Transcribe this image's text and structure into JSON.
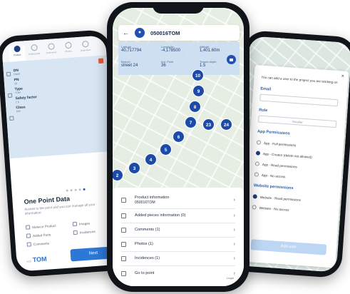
{
  "left": {
    "tabs": [
      {
        "label": "Product",
        "active": true
      },
      {
        "label": "Added parts",
        "active": false
      },
      {
        "label": "Comments",
        "active": false
      },
      {
        "label": "Photos",
        "active": false
      },
      {
        "label": "Incidences",
        "active": false
      }
    ],
    "fields": [
      {
        "key": "DN",
        "value": "DN00"
      },
      {
        "key": "PN",
        "value": "16"
      },
      {
        "key": "Type",
        "value": "TOM"
      },
      {
        "key": "Safety factor",
        "value": "1.6"
      },
      {
        "key": "Class",
        "value": "500"
      }
    ],
    "title": "One Point Data",
    "description": "Access to the point and you can manage all your information:",
    "items": [
      "Molecor Product",
      "Images",
      "Added Parts",
      "Incidences",
      "Comments"
    ],
    "logo_prefix": "eco",
    "logo": "TOM",
    "next_label": "Next"
  },
  "center": {
    "title": "050016TOM",
    "back_icon": "←",
    "info": [
      {
        "label": "Latitude",
        "value": "40,717794"
      },
      {
        "label": "Longitude",
        "value": "-4,178500"
      },
      {
        "label": "Altitude",
        "value": "1,401.60m"
      },
      {
        "label": "Branch",
        "value": "street 24"
      },
      {
        "label": "Km. Point",
        "value": "36"
      },
      {
        "label": "Trench depth",
        "value": "1.5"
      }
    ],
    "markers": [
      "2",
      "3",
      "4",
      "5",
      "6",
      "7",
      "8",
      "9",
      "10",
      "23",
      "24"
    ],
    "rows": [
      {
        "label": "Product information",
        "sub": "050016TOM"
      },
      {
        "label": "Added pieces information (0)",
        "sub": ""
      },
      {
        "label": "Comments (1)",
        "sub": ""
      },
      {
        "label": "Photos (1)",
        "sub": ""
      },
      {
        "label": "Incidences (1)",
        "sub": ""
      },
      {
        "label": "Go to point",
        "sub": ""
      }
    ],
    "chevron": "›",
    "footer": "Legal"
  },
  "right": {
    "close": "×",
    "intro": "You can add a user to the project you are working on",
    "email_label": "Email",
    "role_label": "Role",
    "role_value": "Installer",
    "app_permissions_label": "App Permissions",
    "app_permissions": [
      {
        "label": "App - Full permissions",
        "selected": false
      },
      {
        "label": "App - Creator (delete not allowed)",
        "selected": true
      },
      {
        "label": "App - Read permissions",
        "selected": false
      },
      {
        "label": "App - No access",
        "selected": false
      }
    ],
    "web_permissions_label": "Website permissions",
    "web_permissions": [
      {
        "label": "Website - Read permissions",
        "selected": true
      },
      {
        "label": "Website - No access",
        "selected": false
      }
    ],
    "add_label": "Add user"
  }
}
